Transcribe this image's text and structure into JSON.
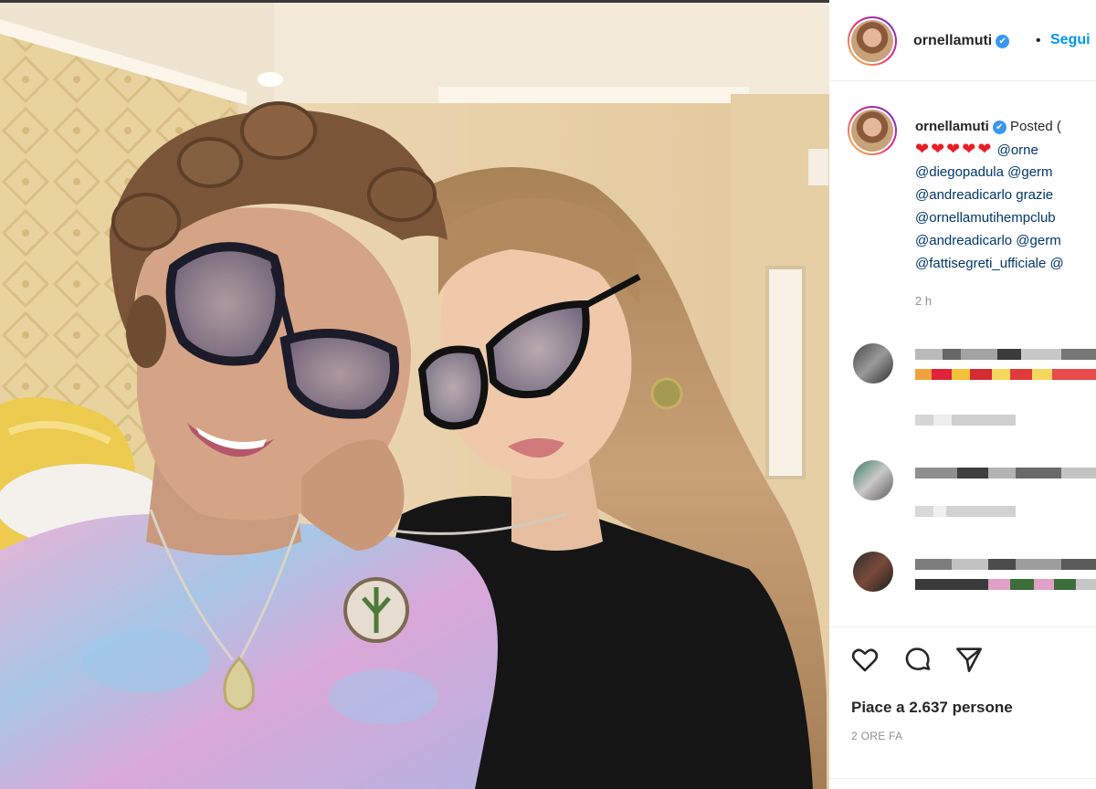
{
  "post": {
    "username": "ornellamuti",
    "verified_mark": "✔",
    "separator": "•",
    "follow_label": "Segui"
  },
  "caption": {
    "username": "ornellamuti",
    "posted_label": "Posted (",
    "hearts": "❤❤❤❤❤",
    "lines": [
      "@orne",
      "@diegopadula @germ",
      "@andreadicarlo grazie",
      "@ornellamutihempclub",
      "@andreadicarlo @germ",
      "@fattisegreti_ufficiale @"
    ],
    "time": "2 h"
  },
  "comments_pixelated": true,
  "actions": {
    "like_icon": "heart-icon",
    "comment_icon": "comment-icon",
    "share_icon": "paper-plane-icon",
    "likes_text": "Piace a 2.637 persone",
    "ago_text": "2 ORE FA"
  },
  "colors": {
    "link": "#00376b",
    "follow": "#0095f6",
    "verified": "#3897f0",
    "muted": "#8e8e8e"
  }
}
